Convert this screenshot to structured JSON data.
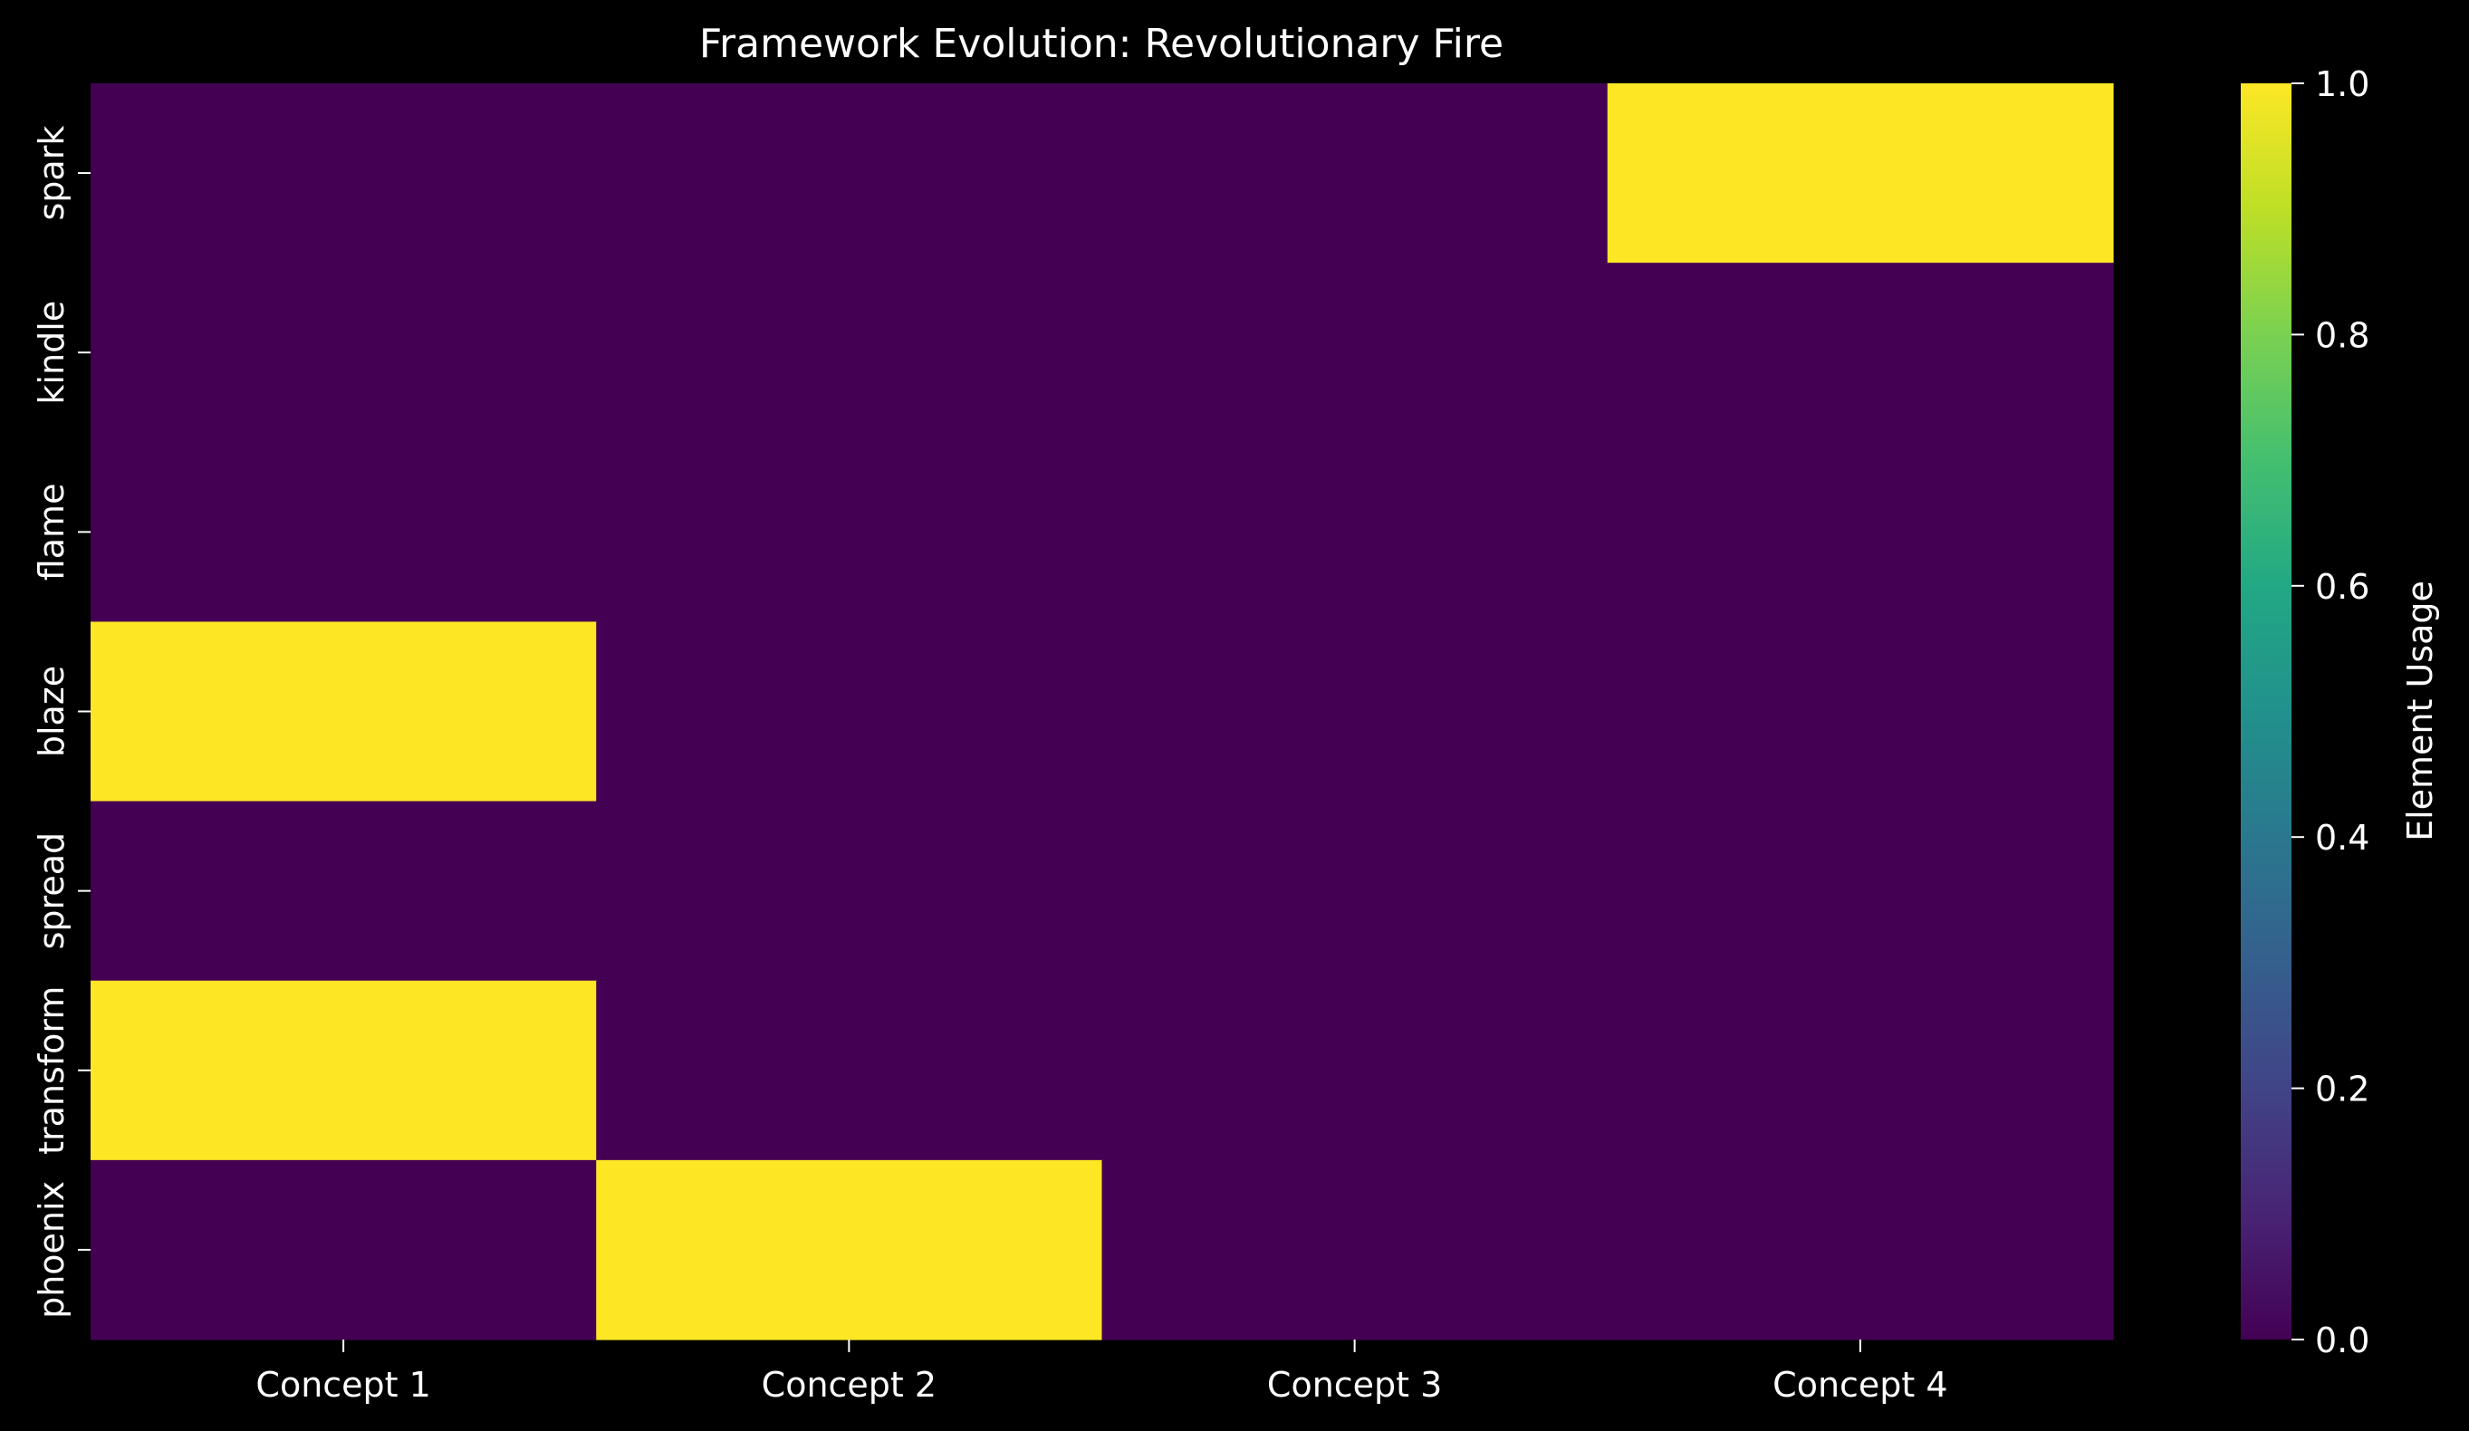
{
  "chart_data": {
    "type": "heatmap",
    "title": "Framework Evolution: Revolutionary Fire",
    "xlabel": "",
    "ylabel": "",
    "columns": [
      "Concept 1",
      "Concept 2",
      "Concept 3",
      "Concept 4"
    ],
    "rows": [
      "spark",
      "kindle",
      "flame",
      "blaze",
      "spread",
      "transform",
      "phoenix"
    ],
    "values": [
      [
        0,
        0,
        0,
        1
      ],
      [
        0,
        0,
        0,
        0
      ],
      [
        0,
        0,
        0,
        0
      ],
      [
        1,
        0,
        0,
        0
      ],
      [
        0,
        0,
        0,
        0
      ],
      [
        1,
        0,
        0,
        0
      ],
      [
        0,
        1,
        0,
        0
      ]
    ],
    "colorbar": {
      "label": "Element Usage",
      "range": [
        0,
        1
      ],
      "ticks": [
        "0.0",
        "0.2",
        "0.4",
        "0.6",
        "0.8",
        "1.0"
      ],
      "colormap": "viridis"
    },
    "colors": {
      "background": "#000000",
      "low": "#440154",
      "high": "#fde725",
      "text": "#ffffff"
    },
    "grid": false
  }
}
